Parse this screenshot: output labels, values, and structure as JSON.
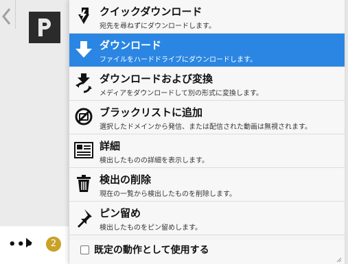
{
  "menu": {
    "items": [
      {
        "title": "クイックダウンロード",
        "desc": "宛先を尋ねずにダウンロードします。",
        "icon": "quick-download-icon"
      },
      {
        "title": "ダウンロード",
        "desc": "ファイルをハードドライブにダウンロードします。",
        "icon": "download-arrow-icon"
      },
      {
        "title": "ダウンロードおよび変換",
        "desc": "メディアをダウンロードして別の形式に変換します。",
        "icon": "download-convert-icon"
      },
      {
        "title": "ブラックリストに追加",
        "desc": "選択したドメインから発信、または配信された動画は無視されます。",
        "icon": "blacklist-icon"
      },
      {
        "title": "詳細",
        "desc": "検出したものの詳細を表示します。",
        "icon": "details-icon"
      },
      {
        "title": "検出の削除",
        "desc": "現在の一覧から検出したものを削除します。",
        "icon": "trash-icon"
      },
      {
        "title": "ピン留め",
        "desc": "検出したものをピン留めします。",
        "icon": "pin-icon"
      }
    ],
    "default_action_label": "既定の動作として使用する",
    "selected_color": "#2a86e2"
  },
  "left": {
    "badge_count": "2",
    "more_label": "•••",
    "badge_color": "#c9a227"
  }
}
